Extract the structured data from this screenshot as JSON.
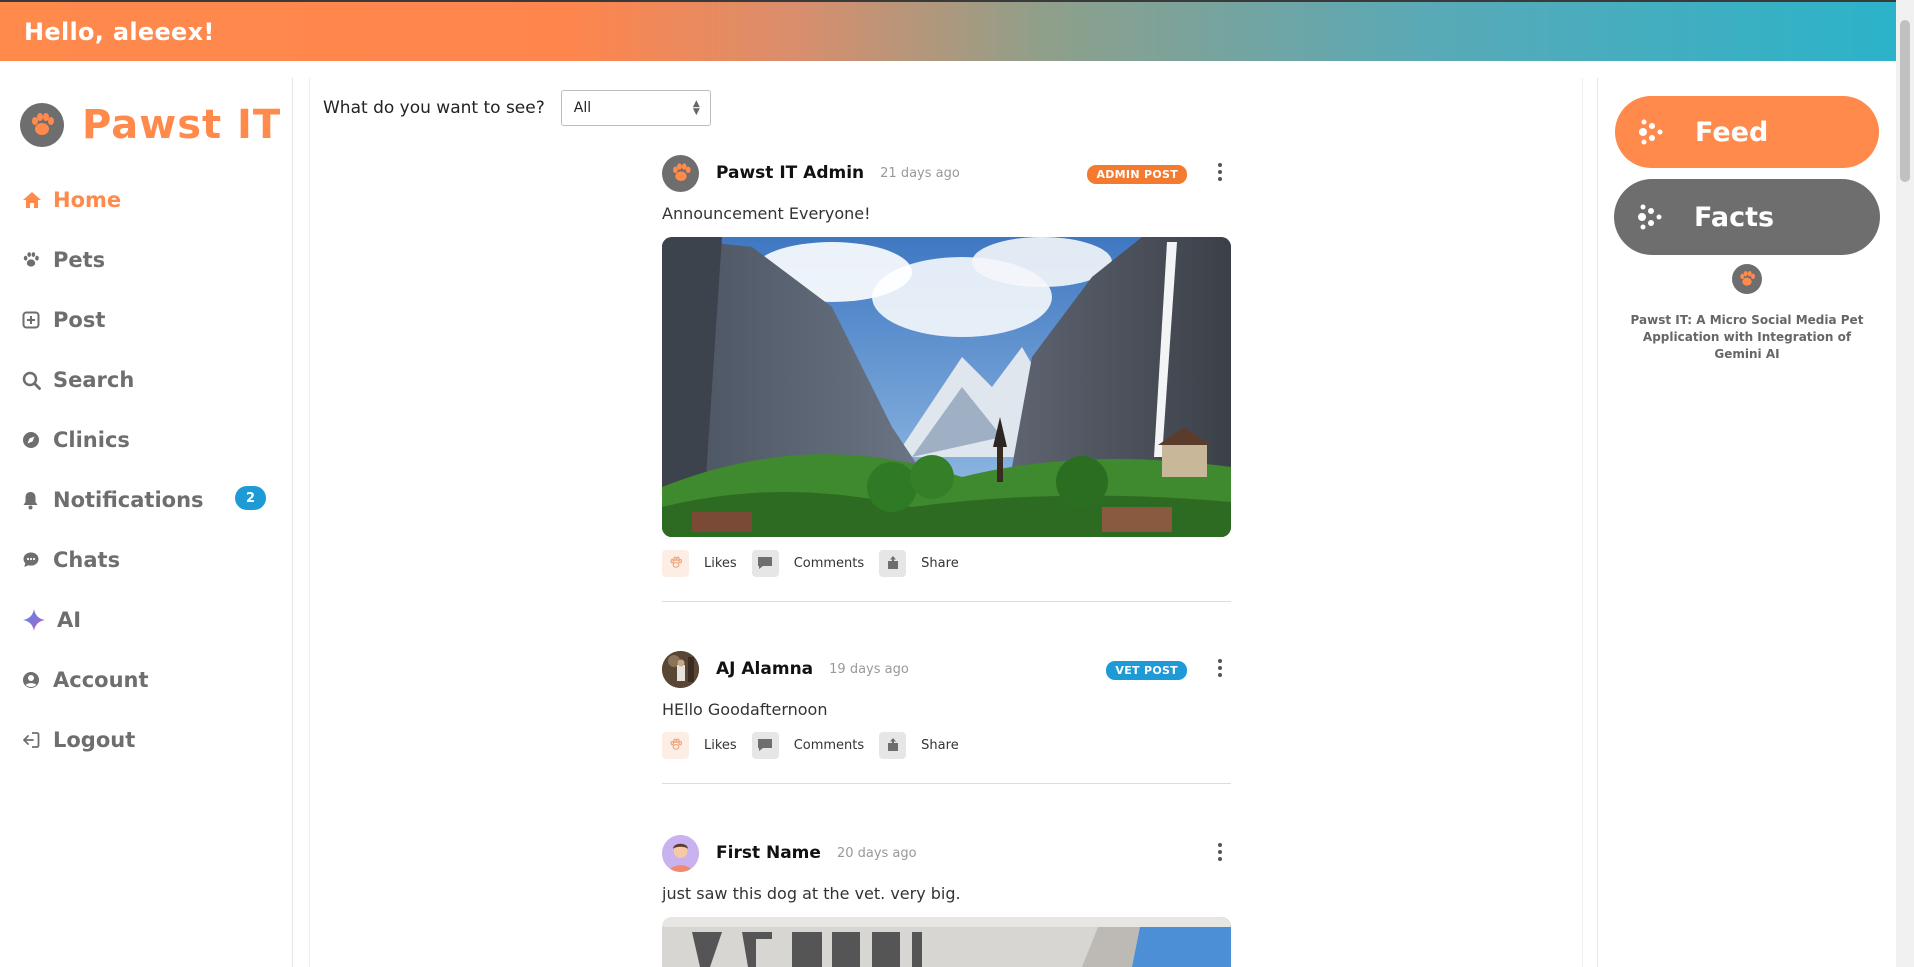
{
  "header": {
    "greeting": "Hello, aleeex!"
  },
  "brand": {
    "name": "Pawst IT"
  },
  "sidebar": {
    "items": [
      {
        "label": "Home",
        "icon": "home-icon",
        "active": true
      },
      {
        "label": "Pets",
        "icon": "paw-icon"
      },
      {
        "label": "Post",
        "icon": "plus-square-icon"
      },
      {
        "label": "Search",
        "icon": "search-icon"
      },
      {
        "label": "Clinics",
        "icon": "compass-icon"
      },
      {
        "label": "Notifications",
        "icon": "bell-icon",
        "badge": "2"
      },
      {
        "label": "Chats",
        "icon": "chat-icon"
      },
      {
        "label": "AI",
        "icon": "sparkle-icon"
      },
      {
        "label": "Account",
        "icon": "user-icon"
      },
      {
        "label": "Logout",
        "icon": "logout-icon"
      }
    ]
  },
  "filter": {
    "question": "What do you want to see?",
    "selected": "All"
  },
  "posts": [
    {
      "author": "Pawst IT Admin",
      "ago": "21 days ago",
      "tag": "ADMIN POST",
      "text": "Announcement Everyone!",
      "has_image": true
    },
    {
      "author": "AJ Alamna",
      "ago": "19 days ago",
      "tag": "VET POST",
      "text": "HEllo Goodafternoon",
      "has_image": false
    },
    {
      "author": "First Name",
      "ago": "20 days ago",
      "tag": "",
      "text": "just saw this dog at the vet. very big.",
      "has_image": true
    }
  ],
  "actions": {
    "likes": "Likes",
    "comments": "Comments",
    "share": "Share"
  },
  "right_panel": {
    "feed_label": "Feed",
    "facts_label": "Facts",
    "tagline": "Pawst IT: A Micro Social Media Pet Application with Integration of Gemini AI"
  },
  "colors": {
    "accent": "#ff8a4c",
    "gray": "#6e6e6e",
    "blue": "#1e9ad6",
    "teal": "#2bb3c9"
  }
}
